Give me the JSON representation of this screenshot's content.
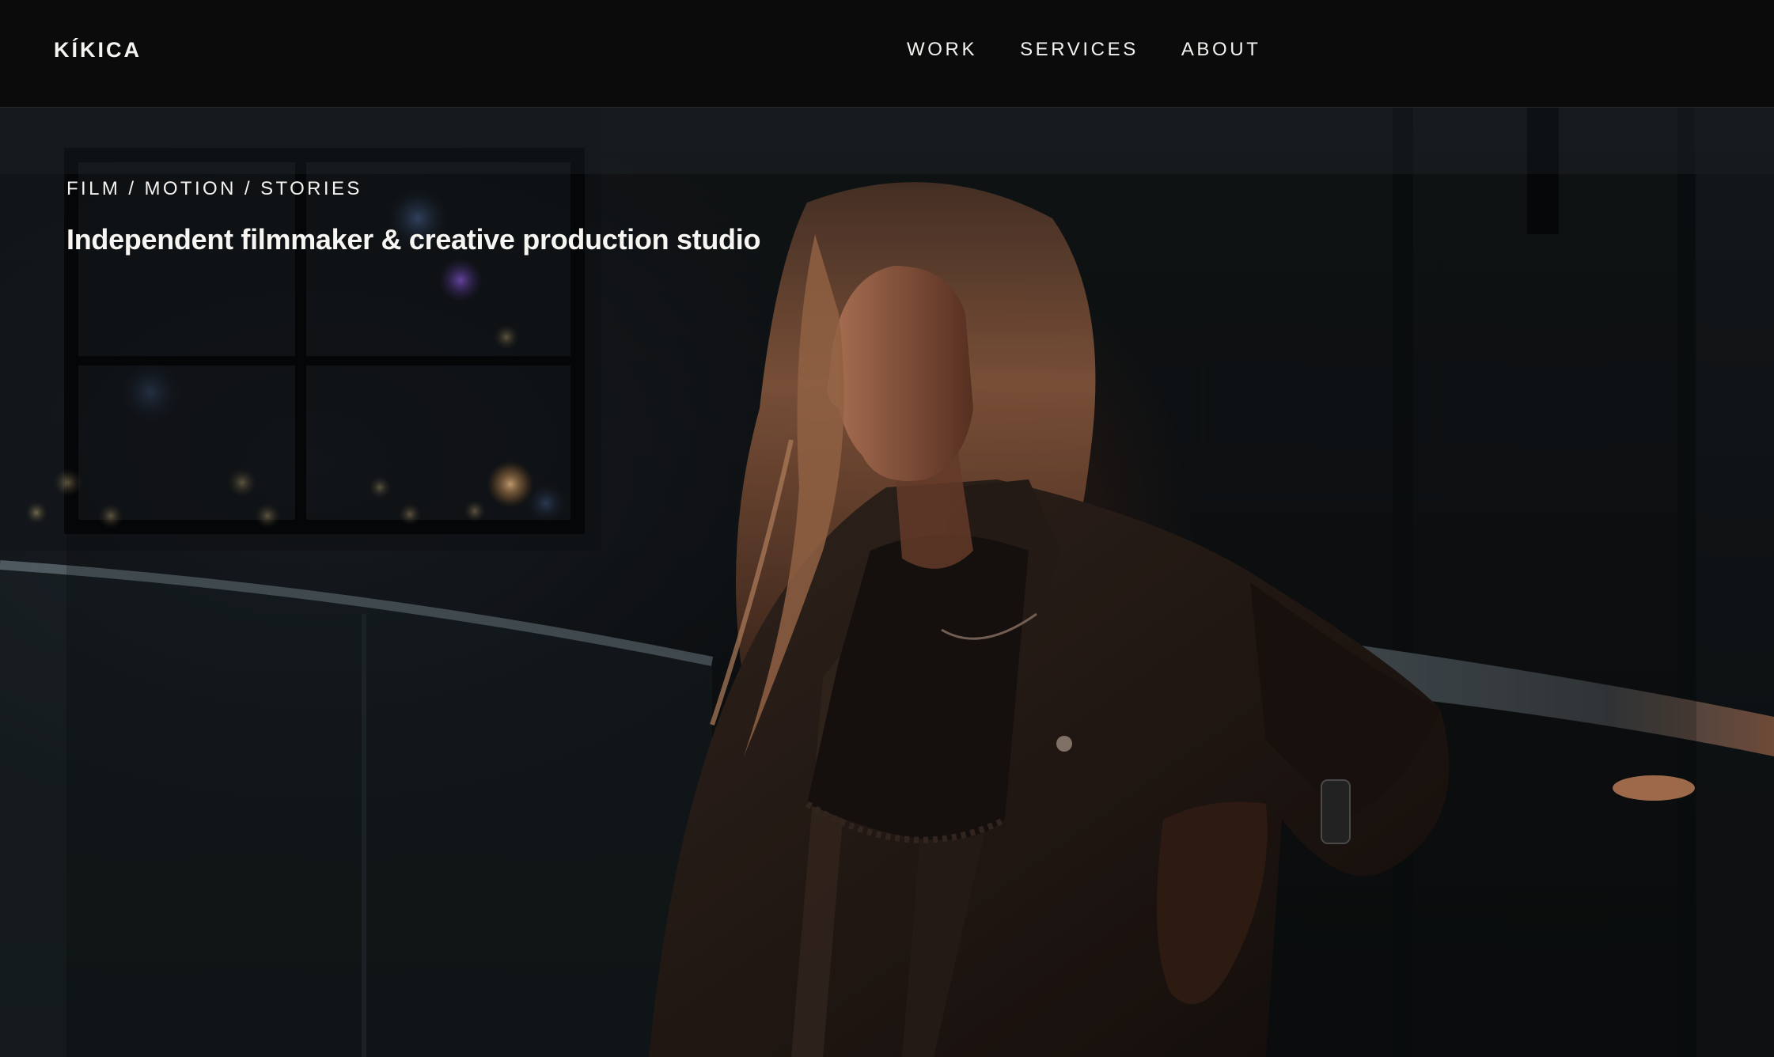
{
  "header": {
    "brand": "KÍKICA",
    "nav": [
      {
        "label": "WORK"
      },
      {
        "label": "SERVICES"
      },
      {
        "label": "ABOUT"
      }
    ]
  },
  "hero": {
    "eyebrow": "FILM / MOTION / STORIES",
    "tagline": "Independent filmmaker & creative production studio",
    "image": "portrait of a woman in a dark blazer leaning on a railing at night, city lights bokeh behind"
  },
  "colors": {
    "background": "#0a0a0a",
    "text": "#f4f2ee",
    "warm_light": "#c9785a",
    "night_blue": "#1c2128"
  }
}
